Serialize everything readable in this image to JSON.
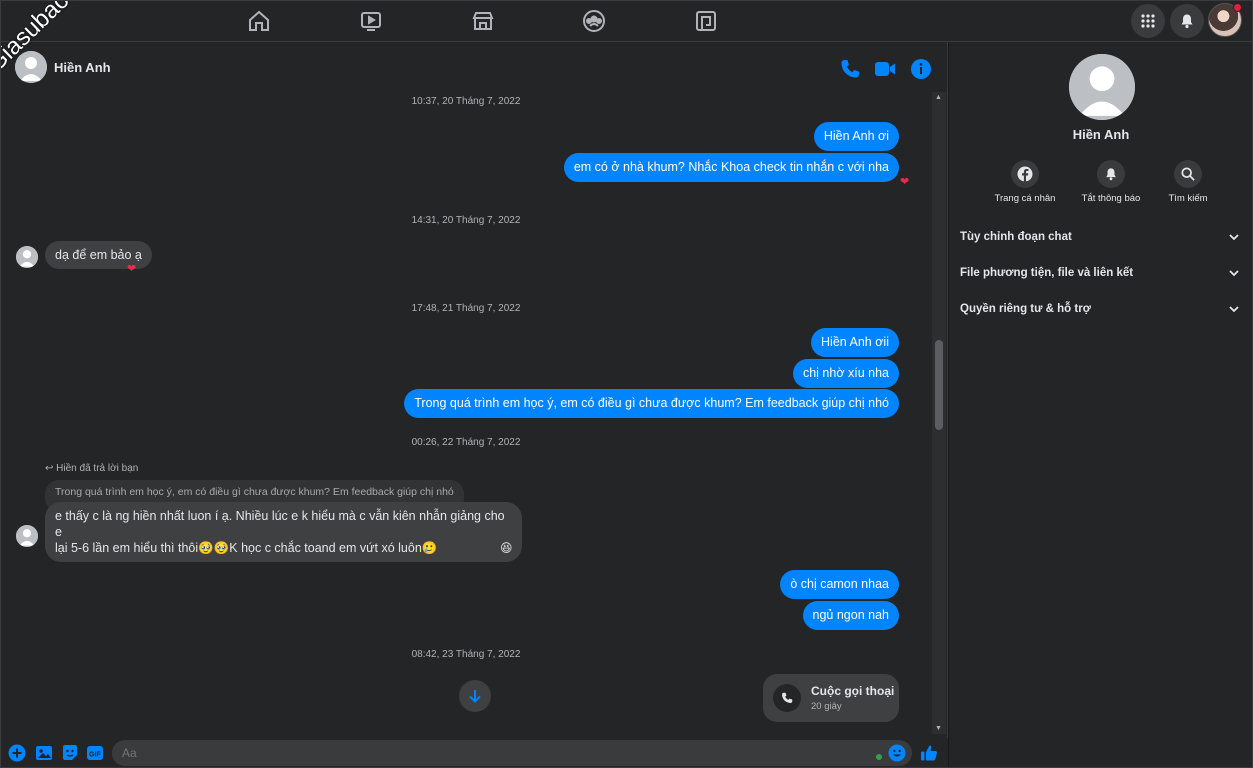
{
  "watermark": "Giasubaochau.net",
  "topnav": {
    "icons": [
      "home-icon",
      "watch-icon",
      "marketplace-icon",
      "groups-icon",
      "gaming-icon"
    ],
    "right_icons": [
      "menu-grid-icon",
      "notifications-icon",
      "profile-avatar"
    ]
  },
  "chat_header": {
    "name": "Hiền Anh",
    "actions": [
      "phone-icon",
      "video-icon",
      "info-icon"
    ]
  },
  "messages": {
    "ts1": "10:37, 20 Tháng 7, 2022",
    "m1": "Hiền Anh ơi",
    "m2": "em có ở nhà khum? Nhắc Khoa check tin nhắn c với nha",
    "ts2": "14:31, 20 Tháng 7, 2022",
    "m3": "dạ để em bảo ạ",
    "ts3": "17:48, 21 Tháng 7, 2022",
    "m4": "Hiền Anh ơii",
    "m5": "chị nhờ xíu nha",
    "m6": "Trong quá trình em học ý, em có điều gì chưa được khum? Em feedback giúp chị nhó",
    "ts4": "00:26, 22 Tháng 7, 2022",
    "reply_label": "Hiền đã trả lời bạn",
    "quoted": "Trong quá trình em học ý, em có điều gì chưa được khum? Em feedback giúp chị nhó",
    "m7_line1": "e thấy c là ng hiền nhất luon í ạ. Nhiều lúc e k hiểu mà c vẫn kiên nhẫn giảng cho e",
    "m7_line2": "lại 5-6 lần em hiểu thì thôi🥹🥹K học c chắc toand em vứt xó luôn🥲",
    "m8": "ò chị camon nhaa",
    "m9": "ngủ ngon nah",
    "ts5": "08:42, 23 Tháng 7, 2022",
    "call_title": "Cuộc gọi thoại",
    "call_duration": "20 giây"
  },
  "reactions": {
    "heart": "❤",
    "laugh": "😆"
  },
  "composer": {
    "placeholder": "Aa",
    "buttons": [
      "plus-icon",
      "photo-icon",
      "sticker-icon",
      "gif-icon",
      "emoji-icon",
      "like-icon"
    ],
    "gif_label": "GIF"
  },
  "side": {
    "name": "Hiền Anh",
    "actions": [
      {
        "label": "Trang cá nhân",
        "icon": "facebook-icon"
      },
      {
        "label": "Tắt thông báo",
        "icon": "bell-icon"
      },
      {
        "label": "Tìm kiếm",
        "icon": "search-icon"
      }
    ],
    "sections": [
      "Tùy chỉnh đoạn chat",
      "File phương tiện, file và liên kết",
      "Quyền riêng tư & hỗ trợ"
    ]
  },
  "colors": {
    "accent": "#0084ff",
    "background": "#242526",
    "incoming_bubble": "#3e4042"
  }
}
